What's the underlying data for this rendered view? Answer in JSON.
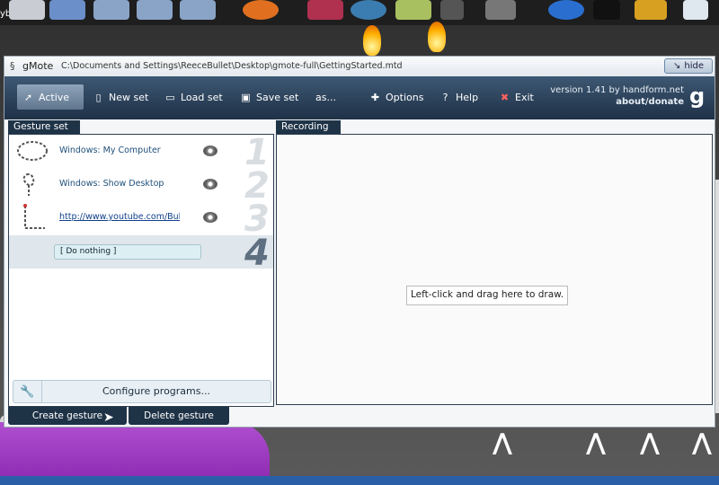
{
  "desktop": {
    "top_label": "yboy"
  },
  "app": {
    "name": "gMote",
    "path": "C:\\Documents and Settings\\ReeceBullet\\Desktop\\gmote-full\\GettingStarted.mtd",
    "hide_label": "hide"
  },
  "toolbar": {
    "items": [
      {
        "label": "Active",
        "icon": "cursor-arrow-icon"
      },
      {
        "label": "New set",
        "icon": "new-document-icon"
      },
      {
        "label": "Load set",
        "icon": "folder-open-icon"
      },
      {
        "label": "Save set",
        "icon": "book-icon"
      },
      {
        "label": "as...",
        "icon": ""
      },
      {
        "label": "Options",
        "icon": "plus-icon"
      },
      {
        "label": "Help",
        "icon": "help-icon"
      },
      {
        "label": "Exit",
        "icon": "close-icon"
      }
    ],
    "version": "version 1.41 by handform.net",
    "about": "about/donate",
    "logo": "g"
  },
  "gesture_set": {
    "tab_label": "Gesture set",
    "rows": [
      {
        "label": "Windows: My Computer",
        "number": "1",
        "glyph": "circle-gesture"
      },
      {
        "label": "Windows: Show Desktop",
        "number": "2",
        "glyph": "loop-gesture"
      },
      {
        "label": "http://www.youtube.com/Bulletc",
        "number": "3",
        "glyph": "l-gesture"
      },
      {
        "label": "[ Do nothing ]",
        "number": "4",
        "glyph": ""
      }
    ],
    "configure_label": "Configure programs..."
  },
  "recording": {
    "tab_label": "Recording",
    "hint": "Left-click and drag here to draw."
  },
  "buttons": {
    "create": "Create gesture",
    "delete": "Delete gesture"
  }
}
